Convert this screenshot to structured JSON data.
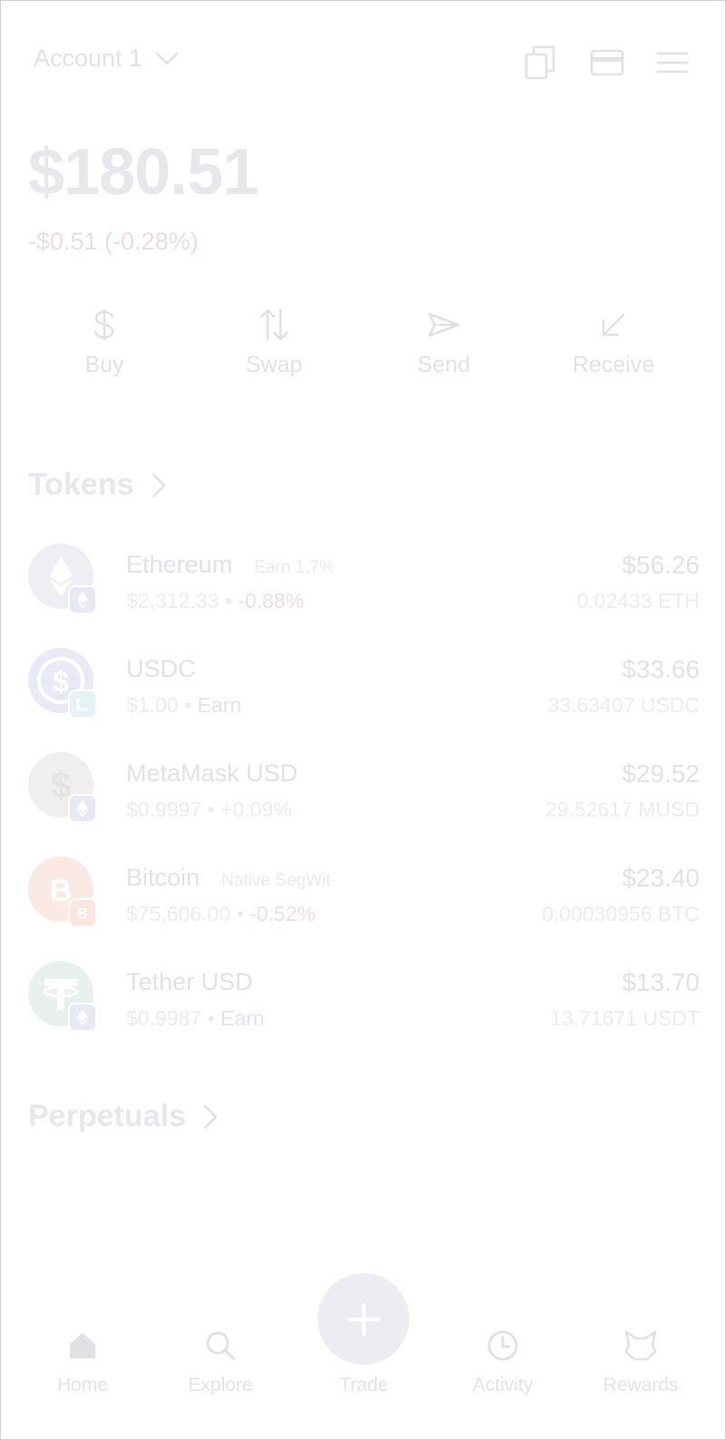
{
  "header": {
    "account_label": "Account 1",
    "icons": [
      "copy-icon",
      "card-icon",
      "menu-icon"
    ]
  },
  "balance": {
    "total": "$180.51",
    "change": "-$0.51 (-0.28%)"
  },
  "actions": [
    {
      "label": "Buy",
      "icon": "dollar-icon"
    },
    {
      "label": "Swap",
      "icon": "swap-arrows-icon"
    },
    {
      "label": "Send",
      "icon": "send-icon"
    },
    {
      "label": "Receive",
      "icon": "receive-arrow-icon"
    }
  ],
  "tokens_section": {
    "title": "Tokens",
    "items": [
      {
        "name": "Ethereum",
        "tag": "Earn 1.7%",
        "price": "$2,312.33",
        "change": "-0.88%",
        "fiat": "$56.26",
        "amount": "0.02433 ETH"
      },
      {
        "name": "USDC",
        "tag": "",
        "price": "$1.00",
        "change": "Earn",
        "fiat": "$33.66",
        "amount": "33.63407 USDC"
      },
      {
        "name": "MetaMask USD",
        "tag": "",
        "price": "$0.9997",
        "change": "+0.09%",
        "fiat": "$29.52",
        "amount": "29.52617 MUSD"
      },
      {
        "name": "Bitcoin",
        "tag": "Native SegWit",
        "price": "$75,606.00",
        "change": "-0.52%",
        "fiat": "$23.40",
        "amount": "0.00030956 BTC"
      },
      {
        "name": "Tether USD",
        "tag": "",
        "price": "$0.9987",
        "change": "Earn",
        "fiat": "$13.70",
        "amount": "13.71671 USDT"
      }
    ]
  },
  "perpetuals_section": {
    "title": "Perpetuals"
  },
  "tabbar": [
    {
      "label": "Home",
      "icon": "home-icon"
    },
    {
      "label": "Explore",
      "icon": "search-icon"
    },
    {
      "label": "Trade",
      "icon": "plus-icon"
    },
    {
      "label": "Activity",
      "icon": "clock-icon"
    },
    {
      "label": "Rewards",
      "icon": "fox-icon"
    }
  ],
  "colors": {
    "text_faded": "#e2e2e6",
    "negative_faded": "#f0dede",
    "earn_faded": "#dfe3f7",
    "trade_button": "#ececf3"
  }
}
